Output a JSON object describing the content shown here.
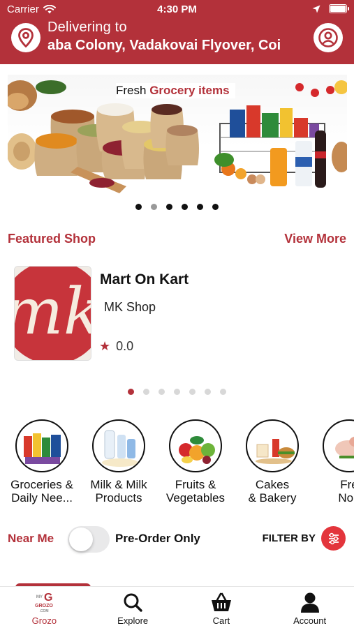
{
  "status_bar": {
    "carrier": "Carrier",
    "time": "4:30 PM"
  },
  "header": {
    "delivering_label": "Delivering to",
    "address": "aba Colony, Vadakovai Flyover, Coi",
    "brand_color": "#b3313a"
  },
  "banner": {
    "caption_prefix": "Fresh",
    "caption_highlight": "Grocery items",
    "slide_count": 6,
    "active_slide_index": 1
  },
  "featured": {
    "title": "Featured Shop",
    "view_more": "View More",
    "shop": {
      "logo_text": "mk",
      "name": "Mart On Kart",
      "subtitle": "MK Shop",
      "rating": "0.0"
    },
    "page_count": 7,
    "active_page_index": 0
  },
  "categories": [
    {
      "label_line1": "Groceries &",
      "label_line2": "Daily Nee...",
      "icon": "groceries-icon"
    },
    {
      "label_line1": "Milk & Milk",
      "label_line2": "Products",
      "icon": "milk-icon"
    },
    {
      "label_line1": "Fruits &",
      "label_line2": "Vegetables",
      "icon": "fruits-icon"
    },
    {
      "label_line1": "Cakes",
      "label_line2": "& Bakery",
      "icon": "cakes-icon"
    },
    {
      "label_line1": "Fre",
      "label_line2": "Non",
      "icon": "meat-icon"
    }
  ],
  "filters": {
    "near_me": "Near Me",
    "pre_order_only": "Pre-Order Only",
    "pre_order_enabled": false,
    "filter_by": "FILTER BY"
  },
  "tabbar": {
    "items": [
      {
        "label": "Grozo",
        "icon": "grozo-logo-icon",
        "logo_lines": [
          "MY",
          "GROZO",
          ".COM"
        ],
        "active": true
      },
      {
        "label": "Explore",
        "icon": "search-icon",
        "active": false
      },
      {
        "label": "Cart",
        "icon": "basket-icon",
        "active": false
      },
      {
        "label": "Account",
        "icon": "person-icon",
        "active": false
      }
    ]
  }
}
